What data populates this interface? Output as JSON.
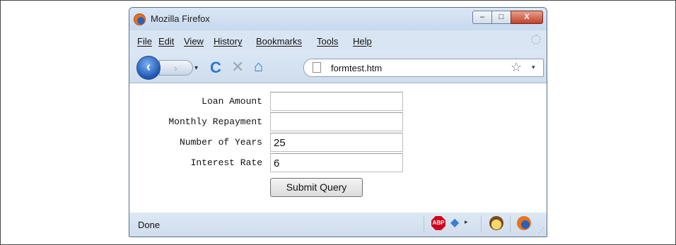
{
  "window": {
    "title": "Mozilla Firefox",
    "controls": {
      "minimize": "–",
      "maximize": "□",
      "close": "X"
    }
  },
  "menu": {
    "items": [
      "File",
      "Edit",
      "View",
      "History",
      "Bookmarks",
      "Tools",
      "Help"
    ]
  },
  "navigation": {
    "back_glyph": "‹",
    "forward_glyph": "›",
    "reload_glyph": "C",
    "stop_glyph": "✕",
    "home_glyph": "⌂",
    "url": "formtest.htm",
    "bookmark_glyph": "☆",
    "dropdown_glyph": "▾"
  },
  "form": {
    "fields": [
      {
        "label": "Loan Amount",
        "value": ""
      },
      {
        "label": "Monthly Repayment",
        "value": ""
      },
      {
        "label": "Number of Years",
        "value": "25"
      },
      {
        "label": "Interest Rate",
        "value": "6"
      }
    ],
    "submit_label": "Submit Query"
  },
  "status": {
    "text": "Done",
    "abp_label": "ABP"
  },
  "icons": {
    "app": "firefox-icon",
    "adblock": "adblock-plus-icon",
    "addon": "addon-icon",
    "greasemonkey": "greasemonkey-icon",
    "firefox_status": "firefox-status-icon"
  }
}
